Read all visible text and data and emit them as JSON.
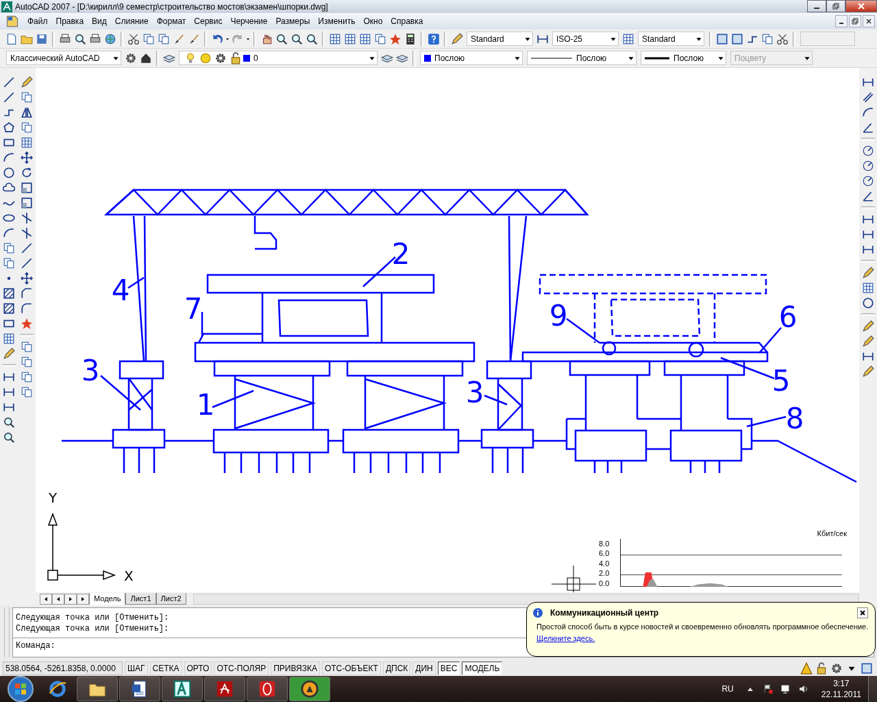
{
  "window": {
    "title": "AutoCAD 2007 - [D:\\кирилл\\9 семестр\\строительство мостов\\экзамен\\шпорки.dwg]"
  },
  "menu": [
    "Файл",
    "Правка",
    "Вид",
    "Слияние",
    "Формат",
    "Сервис",
    "Черчение",
    "Размеры",
    "Изменить",
    "Окно",
    "Справка"
  ],
  "toolbars": {
    "text_style": "Standard",
    "dim_style": "ISO-25",
    "table_style": "Standard",
    "workspace": "Классический AutoCAD",
    "layer": "0",
    "object_color": "Послою",
    "linetype": "Послою",
    "lineweight": "Послою",
    "plot_style": {
      "value": "Поцвету",
      "disabled": true
    }
  },
  "drawing": {
    "callouts": [
      "2",
      "4",
      "7",
      "9",
      "6",
      "3",
      "5",
      "1",
      "3",
      "8"
    ],
    "ucs": {
      "y": "Y",
      "x": "X"
    }
  },
  "layout_tabs": [
    {
      "label": "Модель",
      "selected": true
    },
    {
      "label": "Лист1",
      "selected": false
    },
    {
      "label": "Лист2",
      "selected": false
    }
  ],
  "command_line": {
    "history": [
      "Следующая точка или [Отменить]:",
      "Следующая точка или [Отменить]:"
    ],
    "prompt": "Команда:"
  },
  "status_bar": {
    "coordinates": "538.0564, -5261.8358, 0.0000",
    "toggles": [
      {
        "label": "ШАГ",
        "on": false
      },
      {
        "label": "СЕТКА",
        "on": false
      },
      {
        "label": "ОРТО",
        "on": false
      },
      {
        "label": "ОТС-ПОЛЯР",
        "on": false
      },
      {
        "label": "ПРИВЯЗКА",
        "on": false
      },
      {
        "label": "ОТС-ОБЪЕКТ",
        "on": false
      },
      {
        "label": "ДПСК",
        "on": false
      },
      {
        "label": "ДИН",
        "on": false
      },
      {
        "label": "ВЕС",
        "on": true
      },
      {
        "label": "МОДЕЛЬ",
        "on": true
      }
    ]
  },
  "notification": {
    "title": "Коммуникационный центр",
    "message": "Простой способ быть в курсе новостей и своевременно обновлять программное обеспечение.",
    "link": "Щелкните здесь."
  },
  "traffic_meter": {
    "unit": "Кбит/сек",
    "ticks": [
      "8.0",
      "6.0",
      "4.0",
      "2.0",
      "0.0"
    ]
  },
  "taskbar": {
    "language": "RU",
    "time": "3:17",
    "date": "22.11.2011"
  }
}
